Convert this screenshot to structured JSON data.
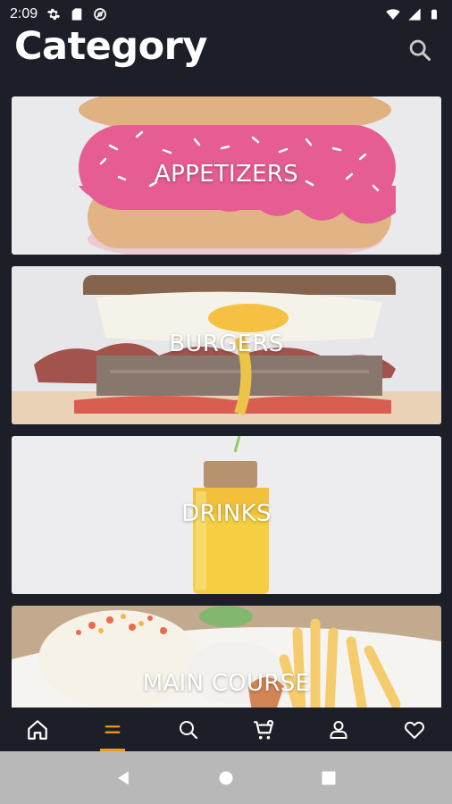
{
  "status_bar": {
    "time": "2:09",
    "icons": [
      "settings-icon",
      "sd-card-icon",
      "do-not-disturb-icon",
      "wifi-icon",
      "signal-icon",
      "battery-icon"
    ]
  },
  "header": {
    "title": "Category",
    "search_icon": "search-icon"
  },
  "categories": [
    {
      "label": "APPETIZERS"
    },
    {
      "label": "BURGERS"
    },
    {
      "label": "DRINKS"
    },
    {
      "label": "MAIN COURSE"
    }
  ],
  "bottom_nav": {
    "items": [
      {
        "name": "home",
        "icon": "home-icon",
        "active": false
      },
      {
        "name": "category",
        "icon": "menu-lines-icon",
        "active": true
      },
      {
        "name": "search",
        "icon": "search-icon",
        "active": false
      },
      {
        "name": "cart",
        "icon": "cart-icon",
        "active": false
      },
      {
        "name": "profile",
        "icon": "person-icon",
        "active": false
      },
      {
        "name": "favorites",
        "icon": "heart-icon",
        "active": false
      }
    ]
  },
  "system_nav": {
    "buttons": [
      "back-icon",
      "home-circle-icon",
      "recents-icon"
    ]
  },
  "colors": {
    "background": "#1c1f28",
    "accent": "#f39a1e",
    "system_nav": "#b8b8b8"
  }
}
